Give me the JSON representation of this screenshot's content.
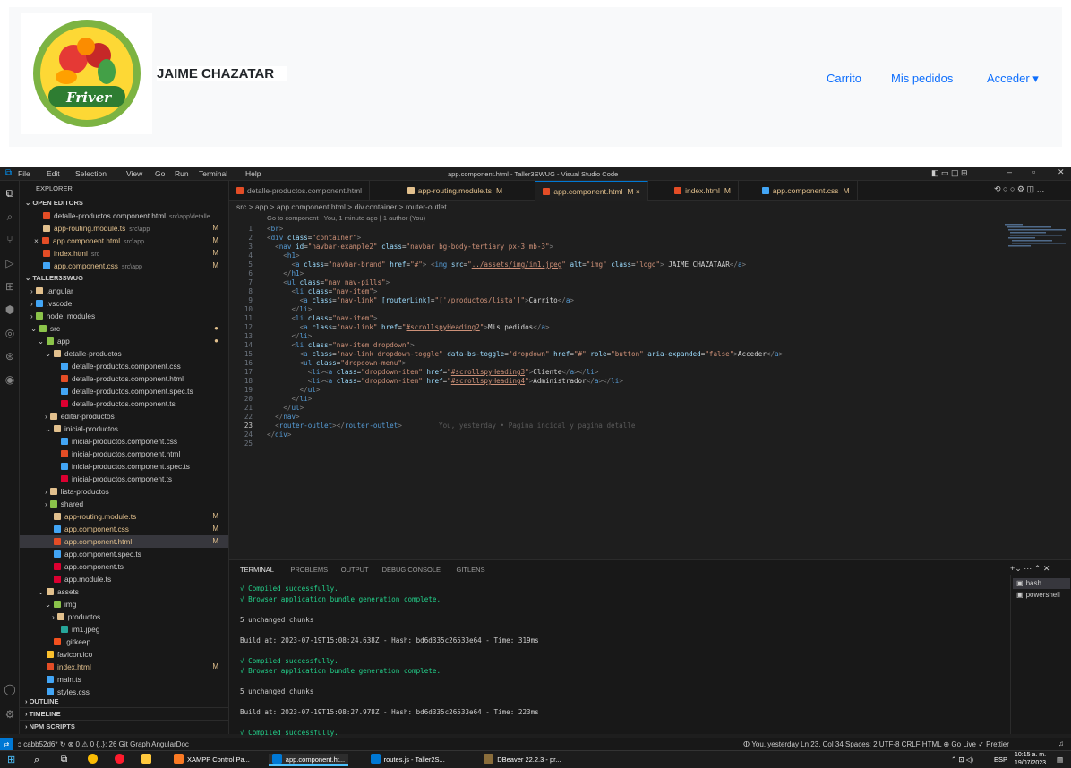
{
  "web": {
    "brand": "JAIME CHAZATAR",
    "logo_text": "Friver",
    "nav": {
      "carrito": "Carrito",
      "pedidos": "Mis pedidos",
      "acceder": "Acceder ▾"
    }
  },
  "vscode": {
    "menu": [
      "File",
      "Edit",
      "Selection",
      "View",
      "Go",
      "Run",
      "Terminal",
      "Help"
    ],
    "window_title": "app.component.html - Taller3SWUG - Visual Studio Code",
    "explorer_title": "EXPLORER",
    "open_editors": {
      "header": "OPEN EDITORS",
      "items": [
        {
          "label": "detalle-productos.component.html",
          "desc": "src\\app\\detalle...",
          "badge": "",
          "color": "#e44d26"
        },
        {
          "label": "app-routing.module.ts",
          "desc": "src\\app",
          "badge": "M",
          "color": "#e2c08d"
        },
        {
          "label": "app.component.html",
          "desc": "src\\app",
          "badge": "M",
          "color": "#e44d26",
          "close": "×"
        },
        {
          "label": "index.html",
          "desc": "src",
          "badge": "M",
          "color": "#e44d26"
        },
        {
          "label": "app.component.css",
          "desc": "src\\app",
          "badge": "M",
          "color": "#42a5f5"
        }
      ]
    },
    "workspace": {
      "header": "TALLER3SWUG",
      "items": [
        {
          "label": ".angular",
          "indent": 1,
          "arrow": "›",
          "color": "#e2c08d"
        },
        {
          "label": ".vscode",
          "indent": 1,
          "arrow": "›",
          "color": "#42a5f5"
        },
        {
          "label": "node_modules",
          "indent": 1,
          "arrow": "›",
          "color": "#8bc34a"
        },
        {
          "label": "src",
          "indent": 1,
          "arrow": "⌄",
          "color": "#8bc34a",
          "dot": true
        },
        {
          "label": "app",
          "indent": 2,
          "arrow": "⌄",
          "color": "#8bc34a",
          "dot": true
        },
        {
          "label": "detalle-productos",
          "indent": 3,
          "arrow": "⌄",
          "color": "#e2c08d"
        },
        {
          "label": "detalle-productos.component.css",
          "indent": 4,
          "color": "#42a5f5"
        },
        {
          "label": "detalle-productos.component.html",
          "indent": 4,
          "color": "#e44d26"
        },
        {
          "label": "detalle-productos.component.spec.ts",
          "indent": 4,
          "color": "#42a5f5"
        },
        {
          "label": "detalle-productos.component.ts",
          "indent": 4,
          "color": "#dd0031"
        },
        {
          "label": "editar-productos",
          "indent": 3,
          "arrow": "›",
          "color": "#e2c08d"
        },
        {
          "label": "inicial-productos",
          "indent": 3,
          "arrow": "⌄",
          "color": "#e2c08d"
        },
        {
          "label": "inicial-productos.component.css",
          "indent": 4,
          "color": "#42a5f5"
        },
        {
          "label": "inicial-productos.component.html",
          "indent": 4,
          "color": "#e44d26"
        },
        {
          "label": "inicial-productos.component.spec.ts",
          "indent": 4,
          "color": "#42a5f5"
        },
        {
          "label": "inicial-productos.component.ts",
          "indent": 4,
          "color": "#dd0031"
        },
        {
          "label": "lista-productos",
          "indent": 3,
          "arrow": "›",
          "color": "#e2c08d"
        },
        {
          "label": "shared",
          "indent": 3,
          "arrow": "›",
          "color": "#8bc34a"
        },
        {
          "label": "app-routing.module.ts",
          "indent": 3,
          "color": "#e2c08d",
          "badge": "M",
          "mod": true
        },
        {
          "label": "app.component.css",
          "indent": 3,
          "color": "#42a5f5",
          "badge": "M",
          "mod": true
        },
        {
          "label": "app.component.html",
          "indent": 3,
          "color": "#e44d26",
          "badge": "M",
          "mod": true,
          "sel": true
        },
        {
          "label": "app.component.spec.ts",
          "indent": 3,
          "color": "#42a5f5"
        },
        {
          "label": "app.component.ts",
          "indent": 3,
          "color": "#dd0031"
        },
        {
          "label": "app.module.ts",
          "indent": 3,
          "color": "#dd0031"
        },
        {
          "label": "assets",
          "indent": 2,
          "arrow": "⌄",
          "color": "#e2c08d"
        },
        {
          "label": "img",
          "indent": 3,
          "arrow": "⌄",
          "color": "#8bc34a"
        },
        {
          "label": "productos",
          "indent": 4,
          "arrow": "›",
          "color": "#e2c08d"
        },
        {
          "label": "im1.jpeg",
          "indent": 4,
          "color": "#26a69a"
        },
        {
          "label": ".gitkeep",
          "indent": 3,
          "color": "#f4511e"
        },
        {
          "label": "favicon.ico",
          "indent": 2,
          "color": "#fbc02d"
        },
        {
          "label": "index.html",
          "indent": 2,
          "color": "#e44d26",
          "badge": "M",
          "mod": true
        },
        {
          "label": "main.ts",
          "indent": 2,
          "color": "#42a5f5"
        },
        {
          "label": "styles.css",
          "indent": 2,
          "color": "#42a5f5"
        }
      ]
    },
    "bottom_sections": [
      "OUTLINE",
      "TIMELINE",
      "NPM SCRIPTS"
    ],
    "tabs": [
      {
        "label": "detalle-productos.component.html",
        "status": "",
        "color": "#e44d26"
      },
      {
        "label": "app-routing.module.ts",
        "status": "M",
        "color": "#e2c08d"
      },
      {
        "label": "app.component.html",
        "status": "M ×",
        "color": "#e44d26",
        "active": true
      },
      {
        "label": "index.html",
        "status": "M",
        "color": "#e44d26"
      },
      {
        "label": "app.component.css",
        "status": "M",
        "color": "#42a5f5"
      }
    ],
    "breadcrumb": "src > app > app.component.html > div.container > router-outlet",
    "codelens": "Go to component | You, 1 minute ago | 1 author (You)",
    "code_lines": [
      "1",
      "2",
      "3",
      "4",
      "5",
      "6",
      "7",
      "8",
      "9",
      "10",
      "11",
      "12",
      "13",
      "14",
      "15",
      "16",
      "17",
      "18",
      "19",
      "20",
      "21",
      "22",
      "23",
      "24",
      "25"
    ],
    "blame": "You, yesterday • Pagina incical y pagina detalle",
    "panel_tabs": [
      "TERMINAL",
      "PROBLEMS",
      "OUTPUT",
      "DEBUG CONSOLE",
      "GITLENS"
    ],
    "terminal": [
      {
        "text": "√ Compiled successfully.",
        "ok": true
      },
      {
        "text": "√ Browser application bundle generation complete.",
        "ok": true
      },
      {
        "text": "",
        "ok": false
      },
      {
        "text": "5 unchanged chunks",
        "ok": false
      },
      {
        "text": "",
        "ok": false
      },
      {
        "text": "Build at: 2023-07-19T15:08:24.638Z - Hash: bd6d335c26533e64 - Time: 319ms",
        "ok": false
      },
      {
        "text": "",
        "ok": false
      },
      {
        "text": "√ Compiled successfully.",
        "ok": true
      },
      {
        "text": "√ Browser application bundle generation complete.",
        "ok": true
      },
      {
        "text": "",
        "ok": false
      },
      {
        "text": "5 unchanged chunks",
        "ok": false
      },
      {
        "text": "",
        "ok": false
      },
      {
        "text": "Build at: 2023-07-19T15:08:27.978Z - Hash: bd6d335c26533e64 - Time: 223ms",
        "ok": false
      },
      {
        "text": "",
        "ok": false
      },
      {
        "text": "√ Compiled successfully.",
        "ok": true
      }
    ],
    "terminals": [
      "bash",
      "powershell"
    ],
    "status_left": "ↄ cabb52d6* ↻  ⊗ 0 ⚠ 0  {..}: 26  Git Graph  AngularDoc",
    "status_right": "ⵀ You, yesterday   Ln 23, Col 34   Spaces: 2   UTF-8   CRLF   HTML   ⊕ Go Live   ✓ Prettier"
  },
  "taskbar": {
    "apps": [
      {
        "label": "XAMPP Control Pa...",
        "color": "#fb7a24"
      },
      {
        "label": "app.component.ht...",
        "color": "#0078d4"
      },
      {
        "label": "routes.js - Taller2S...",
        "color": "#0078d4"
      },
      {
        "label": "DBeaver 22.2.3 - pr...",
        "color": "#8a6d3b"
      }
    ],
    "lang": "ESP",
    "time": "10:15 a. m.",
    "date": "19/07/2023"
  }
}
